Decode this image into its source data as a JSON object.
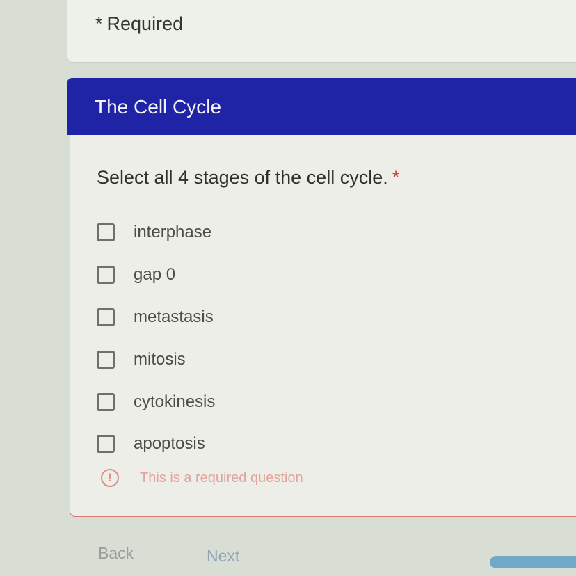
{
  "header": {
    "required_star": "*",
    "required_label": "Required"
  },
  "section": {
    "title": "The Cell Cycle"
  },
  "question": {
    "text": "Select all 4 stages of the cell cycle.",
    "required_star": "*",
    "options": [
      {
        "label": "interphase",
        "checked": false
      },
      {
        "label": "gap 0",
        "checked": false
      },
      {
        "label": "metastasis",
        "checked": false
      },
      {
        "label": "mitosis",
        "checked": false
      },
      {
        "label": "cytokinesis",
        "checked": false
      },
      {
        "label": "apoptosis",
        "checked": false
      }
    ],
    "error_icon": "!",
    "error_message": "This is a required question"
  },
  "navigation": {
    "back_label": "Back",
    "next_label": "Next"
  },
  "progress": {
    "fraction": 1.0
  },
  "colors": {
    "header_bar": "#1f24a6",
    "required_star": "#d2433a",
    "error": "#d98f88",
    "card_border_error": "#d9776f",
    "progress": "#6fa9c8"
  }
}
